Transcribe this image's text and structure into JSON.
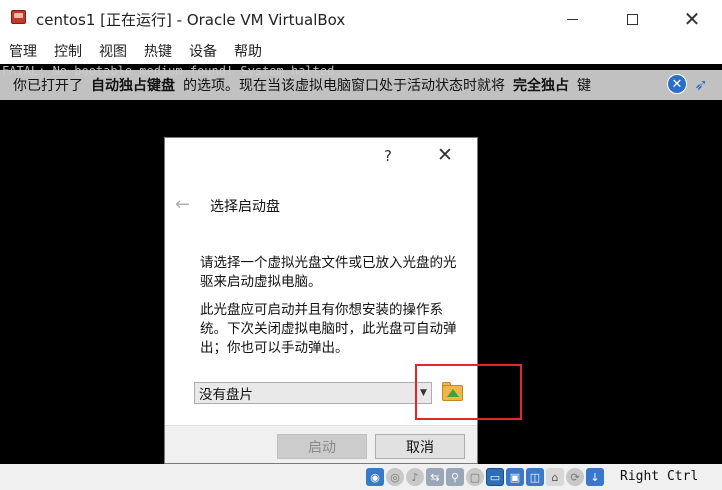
{
  "window": {
    "title": "centos1 [正在运行] - Oracle VM VirtualBox",
    "minimize_glyph": "—",
    "close_glyph": "✕"
  },
  "menu": {
    "items": [
      {
        "label": "管理"
      },
      {
        "label": "控制"
      },
      {
        "label": "视图"
      },
      {
        "label": "热键"
      },
      {
        "label": "设备"
      },
      {
        "label": "帮助"
      }
    ]
  },
  "vm": {
    "console_text": "FATAL: No bootable medium found! System halted.",
    "notice": {
      "text_prefix": "你已打开了",
      "bold1": "自动独占键盘",
      "text_mid": "的选项。现在当该虚拟电脑窗口处于活动状态时就将",
      "bold2": "完全独占",
      "text_suffix": "键"
    }
  },
  "dialog": {
    "help": "?",
    "close": "✕",
    "back_arrow": "←",
    "heading": "选择启动盘",
    "paragraph1": "请选择一个虚拟光盘文件或已放入光盘的光驱来启动虚拟电脑。",
    "paragraph2": "此光盘应可启动并且有你想安装的操作系统。下次关闭虚拟电脑时，此光盘可自动弹出；你也可以手动弹出。",
    "disk_select": {
      "value": "没有盘片"
    },
    "buttons": {
      "start": "启动",
      "cancel": "取消"
    }
  },
  "statusbar": {
    "host_key": "Right Ctrl"
  },
  "colors": {
    "highlight": "#e0282e",
    "accent": "#2a6fc6"
  }
}
